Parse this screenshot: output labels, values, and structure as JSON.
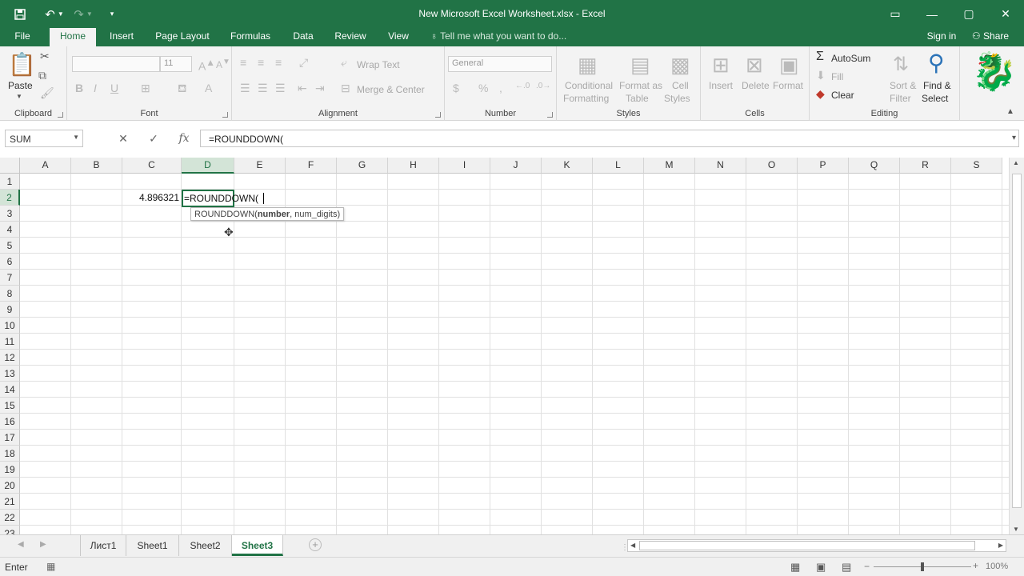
{
  "window": {
    "title": "New Microsoft Excel Worksheet.xlsx - Excel",
    "brand_color": "#217346"
  },
  "qat": {
    "save_icon": "save-icon",
    "undo_icon": "undo-icon",
    "redo_icon": "redo-icon",
    "customize_icon": "customize-qat-icon"
  },
  "tabs": [
    "File",
    "Home",
    "Insert",
    "Page Layout",
    "Formulas",
    "Data",
    "Review",
    "View"
  ],
  "active_tab": "Home",
  "tell_me": "Tell me what you want to do...",
  "account": {
    "sign_in": "Sign in",
    "share": "Share"
  },
  "ribbon": {
    "clipboard": {
      "name": "Clipboard",
      "paste": "Paste"
    },
    "font": {
      "name": "Font",
      "font_name": "",
      "font_size": "11"
    },
    "alignment": {
      "name": "Alignment",
      "wrap_text": "Wrap Text",
      "merge_center": "Merge & Center"
    },
    "number": {
      "name": "Number",
      "format": "General"
    },
    "styles": {
      "name": "Styles",
      "conditional_1": "Conditional",
      "conditional_2": "Formatting",
      "format_table_1": "Format as",
      "format_table_2": "Table",
      "cell_styles_1": "Cell",
      "cell_styles_2": "Styles"
    },
    "cells": {
      "name": "Cells",
      "insert": "Insert",
      "delete": "Delete",
      "format": "Format"
    },
    "editing": {
      "name": "Editing",
      "autosum": "AutoSum",
      "fill": "Fill",
      "clear": "Clear",
      "sort_1": "Sort &",
      "sort_2": "Filter",
      "find_1": "Find &",
      "find_2": "Select"
    }
  },
  "formula_bar": {
    "name_box": "SUM",
    "formula": "=ROUNDDOWN("
  },
  "grid": {
    "columns": [
      "A",
      "B",
      "C",
      "D",
      "E",
      "F",
      "G",
      "H",
      "I",
      "J",
      "K",
      "L",
      "M",
      "N",
      "O",
      "P",
      "Q",
      "R",
      "S"
    ],
    "rows": [
      "1",
      "2",
      "3",
      "4",
      "5",
      "6",
      "7",
      "8",
      "9",
      "10",
      "11",
      "12",
      "13",
      "14",
      "15",
      "16",
      "17",
      "18",
      "19",
      "20",
      "21",
      "22",
      "23"
    ],
    "selected_column": "D",
    "selected_row": "2",
    "c2_value": "4.896321",
    "d2_editing": "=ROUNDDOWN(",
    "tooltip": {
      "fn": "ROUNDDOWN(",
      "arg1": "number",
      "rest": ", num_digits)"
    }
  },
  "sheets": [
    "Лист1",
    "Sheet1",
    "Sheet2",
    "Sheet3"
  ],
  "active_sheet": "Sheet3",
  "status": {
    "mode": "Enter",
    "zoom": "100%"
  }
}
